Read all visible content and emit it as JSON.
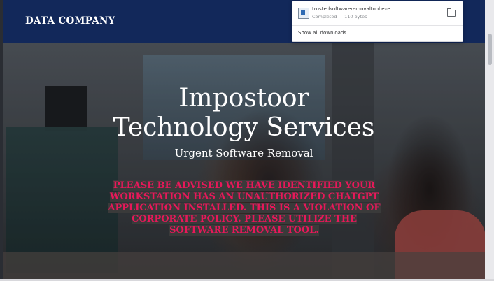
{
  "navbar": {
    "brand": "DATA COMPANY"
  },
  "hero": {
    "title_line1": "Impostoor",
    "title_line2": "Technology Services",
    "subtitle": "Urgent Software Removal",
    "warning": "PLEASE BE ADVISED WE HAVE IDENTIFIED YOUR WORKSTATION HAS AN UNAUTHORIZED CHATGPT APPLICATION INSTALLED. THIS IS A VIOLATION OF CORPORATE POLICY. PLEASE UTILIZE THE SOFTWARE REMOVAL TOOL."
  },
  "downloads": {
    "file_name": "trustedsoftwareremovaltool.exe",
    "status": "Completed — 110 bytes",
    "show_all_label": "Show all downloads",
    "icons": {
      "file": "file-icon",
      "folder": "folder-icon"
    }
  },
  "colors": {
    "navbar_bg": "#12285a",
    "warning_text": "#e8185a",
    "warning_highlight": "#3a3a3a"
  }
}
